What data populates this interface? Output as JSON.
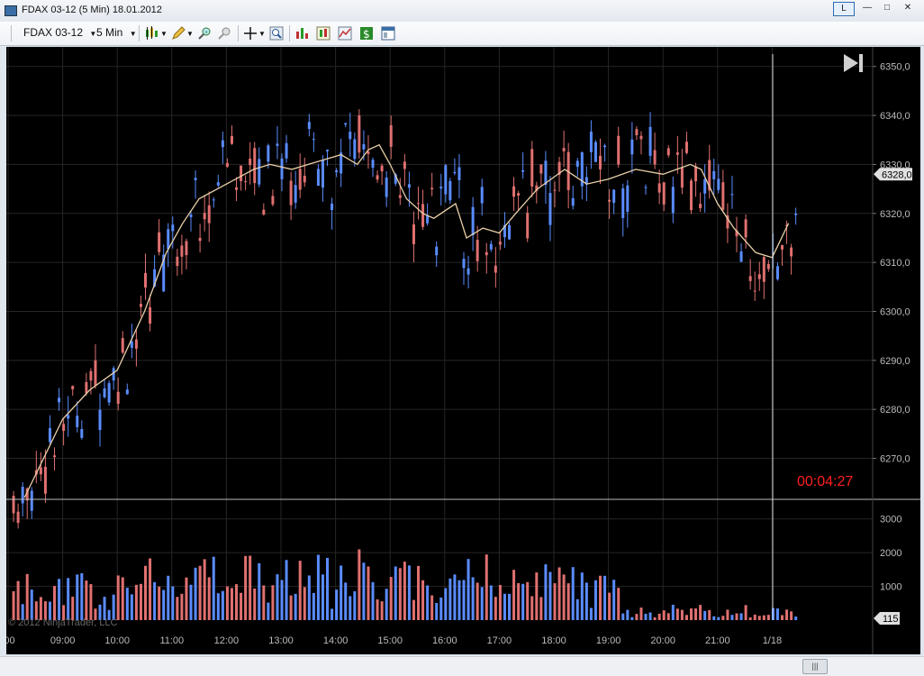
{
  "window": {
    "title": "FDAX 03-12 (5 Min)  18.01.2012",
    "buttons": [
      "L",
      "—",
      "□",
      "✕"
    ]
  },
  "toolbar": {
    "instrument": "FDAX 03-12",
    "interval": "5 Min",
    "icons": [
      "candlestick-style-icon",
      "pencil-draw-icon",
      "zoom-in-icon",
      "zoom-out-icon",
      "crosshair-icon",
      "magnifier-icon",
      "bar-chart-icon",
      "candle-properties-icon",
      "indicator-icon",
      "dollar-icon",
      "template-icon"
    ]
  },
  "chart": {
    "colors": {
      "up": "#5a8cff",
      "down": "#e07070",
      "sma": "#e9d0a8",
      "background": "#000000",
      "grid": "#262626",
      "countdown": "#ff2020"
    },
    "price_ticks": [
      "6270,0",
      "6280,0",
      "6290,0",
      "6300,0",
      "6310,0",
      "6320,0",
      "6330,0",
      "6340,0",
      "6350,0"
    ],
    "current_price_label": "6328,0",
    "volume_ticks": [
      "1000",
      "2000",
      "3000"
    ],
    "volume_current_label": "115",
    "time_ticks": [
      ":00",
      "09:00",
      "10:00",
      "11:00",
      "12:00",
      "13:00",
      "14:00",
      "15:00",
      "16:00",
      "17:00",
      "18:00",
      "19:00",
      "20:00",
      "21:00",
      "1/18"
    ],
    "countdown": "00:04:27",
    "copyright": "© 2012 NinjaTrader, LLC",
    "go_to_end_icon": "skip-to-end-icon"
  },
  "chart_data": {
    "type": "candlestick",
    "ylim": [
      6262,
      6354
    ],
    "volume_ylim": [
      0,
      3500
    ],
    "sma_points": [
      [
        0.3,
        6262
      ],
      [
        1,
        6278
      ],
      [
        1.5,
        6284
      ],
      [
        2,
        6288
      ],
      [
        2.5,
        6300
      ],
      [
        2.9,
        6312
      ],
      [
        3.2,
        6318
      ],
      [
        3.5,
        6323
      ],
      [
        4,
        6326
      ],
      [
        4.5,
        6329
      ],
      [
        4.8,
        6330
      ],
      [
        5.2,
        6329
      ],
      [
        5.5,
        6330
      ],
      [
        5.8,
        6331
      ],
      [
        6.1,
        6332
      ],
      [
        6.4,
        6330
      ],
      [
        6.6,
        6333
      ],
      [
        6.8,
        6334
      ],
      [
        7,
        6330
      ],
      [
        7.3,
        6323
      ],
      [
        7.6,
        6320
      ],
      [
        7.8,
        6319
      ],
      [
        8.2,
        6322
      ],
      [
        8.4,
        6315
      ],
      [
        8.7,
        6317
      ],
      [
        9,
        6316
      ],
      [
        9.3,
        6320
      ],
      [
        9.7,
        6325
      ],
      [
        10.2,
        6329
      ],
      [
        10.6,
        6326
      ],
      [
        11,
        6327
      ],
      [
        11.5,
        6329
      ],
      [
        12,
        6328
      ],
      [
        12.5,
        6330
      ],
      [
        12.7,
        6329
      ],
      [
        13,
        6322
      ],
      [
        13.3,
        6317
      ],
      [
        13.7,
        6312
      ],
      [
        14,
        6311
      ],
      [
        14.3,
        6318
      ]
    ]
  }
}
